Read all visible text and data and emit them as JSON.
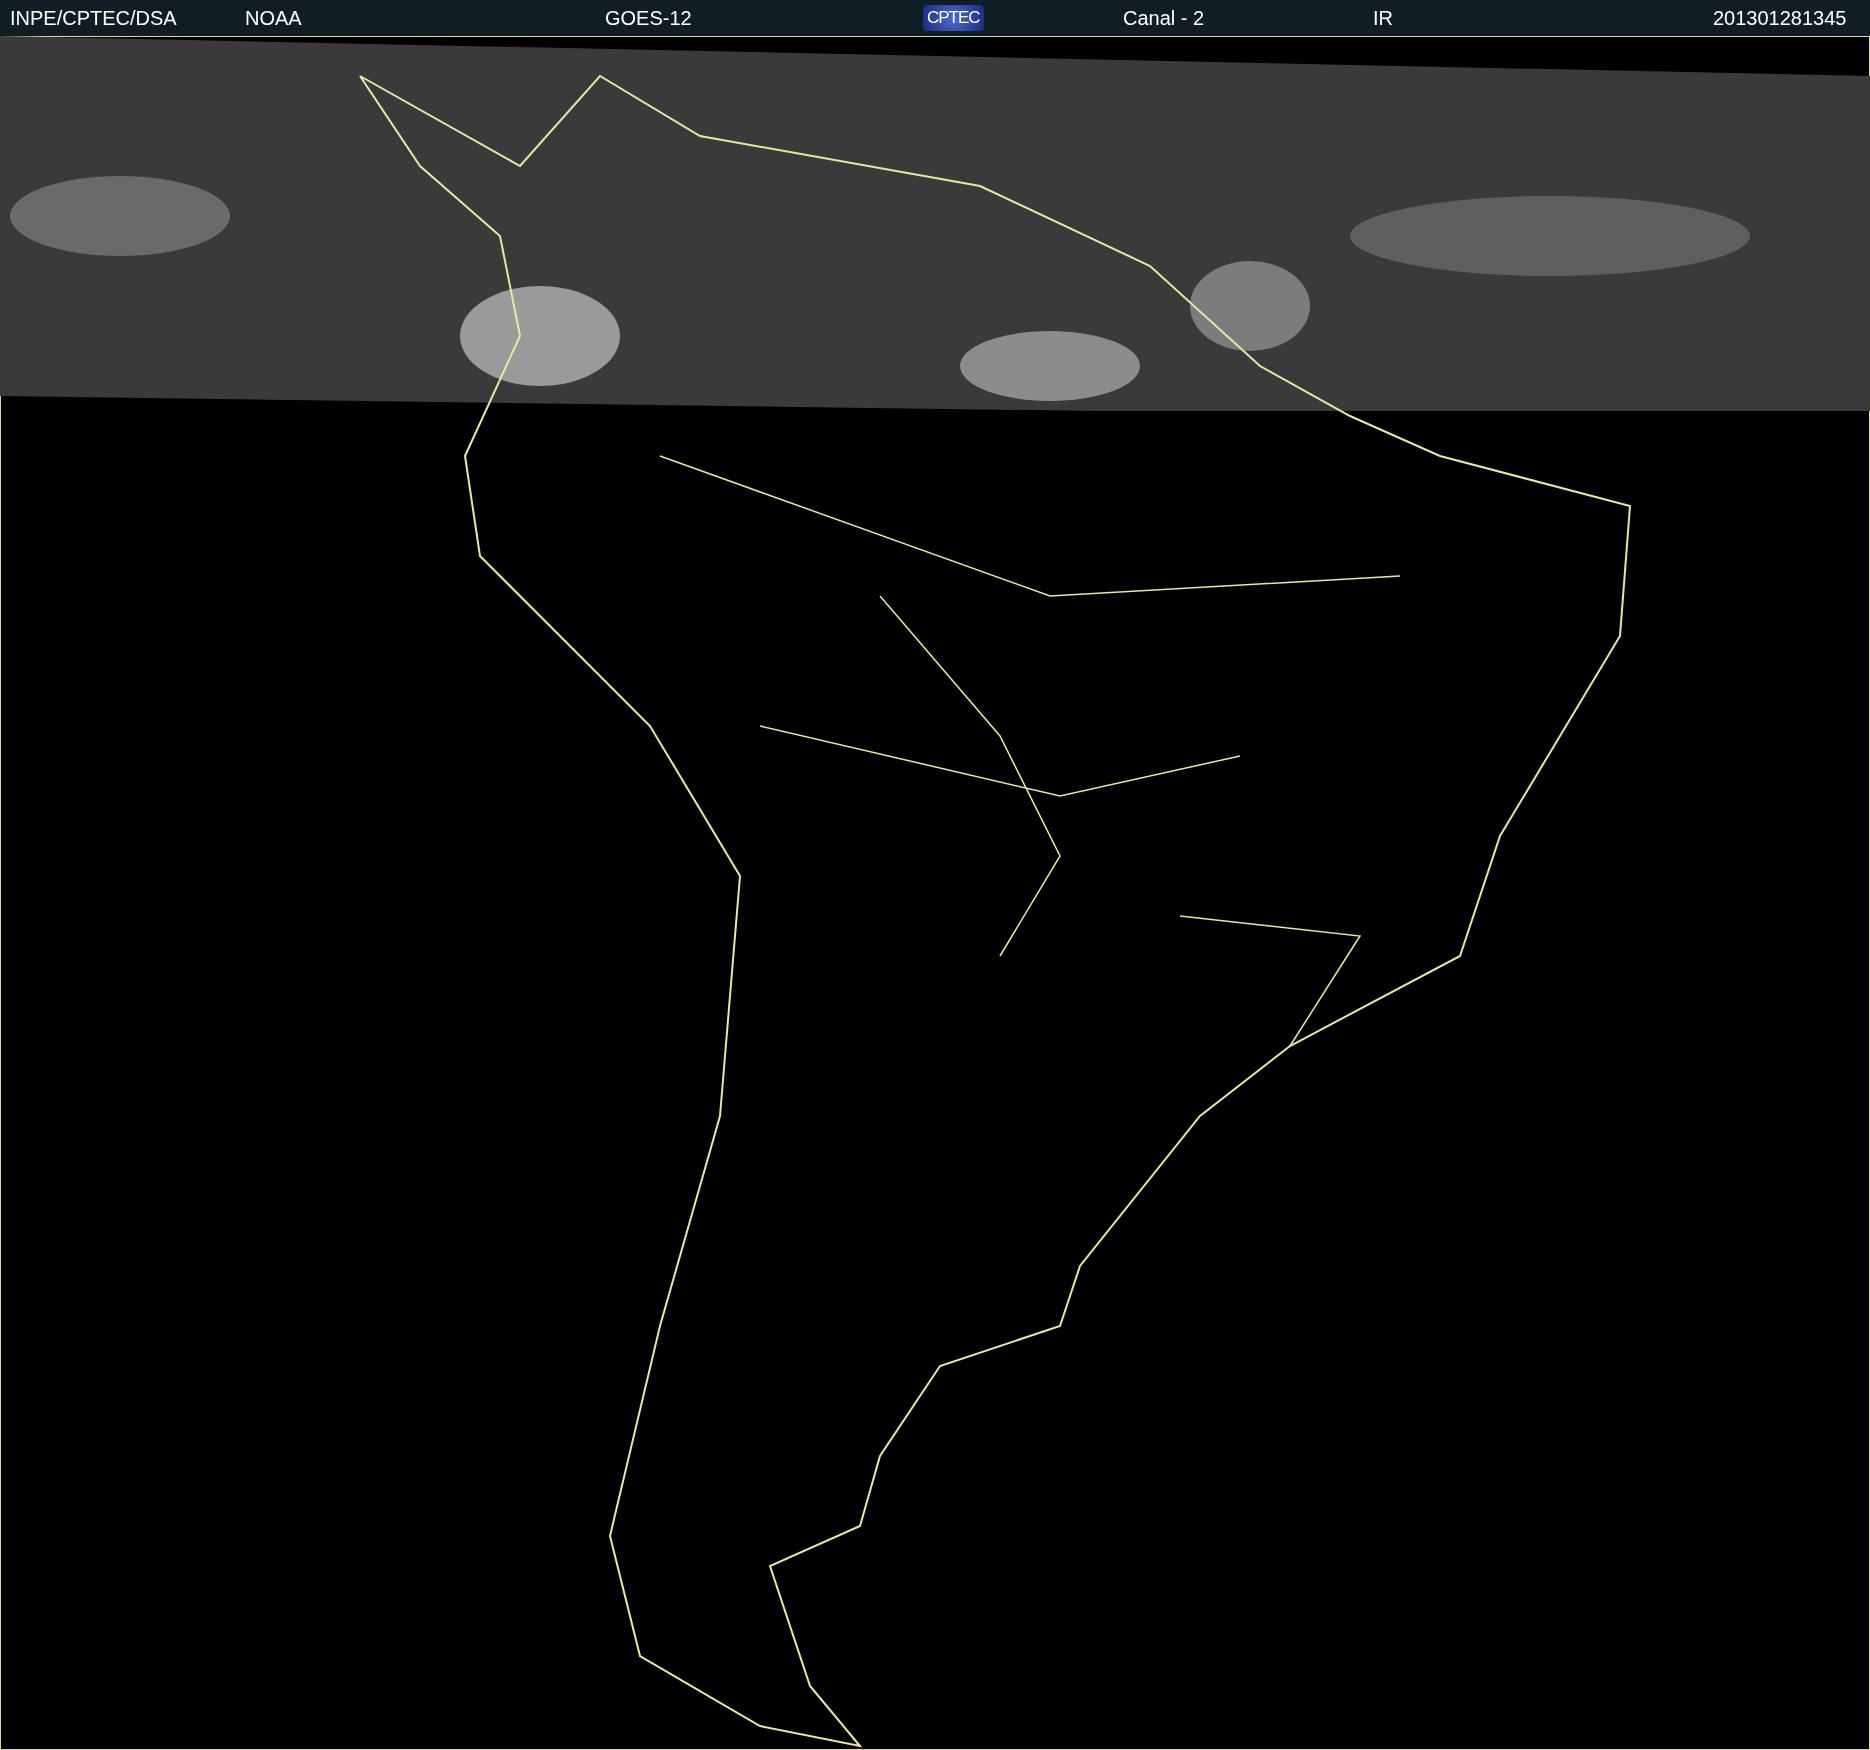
{
  "header": {
    "source": "INPE/CPTEC/DSA",
    "agency": "NOAA",
    "satellite": "GOES-12",
    "logo": "CPTEC",
    "channel": "Canal - 2",
    "band": "IR",
    "timestamp": "201301281345"
  }
}
